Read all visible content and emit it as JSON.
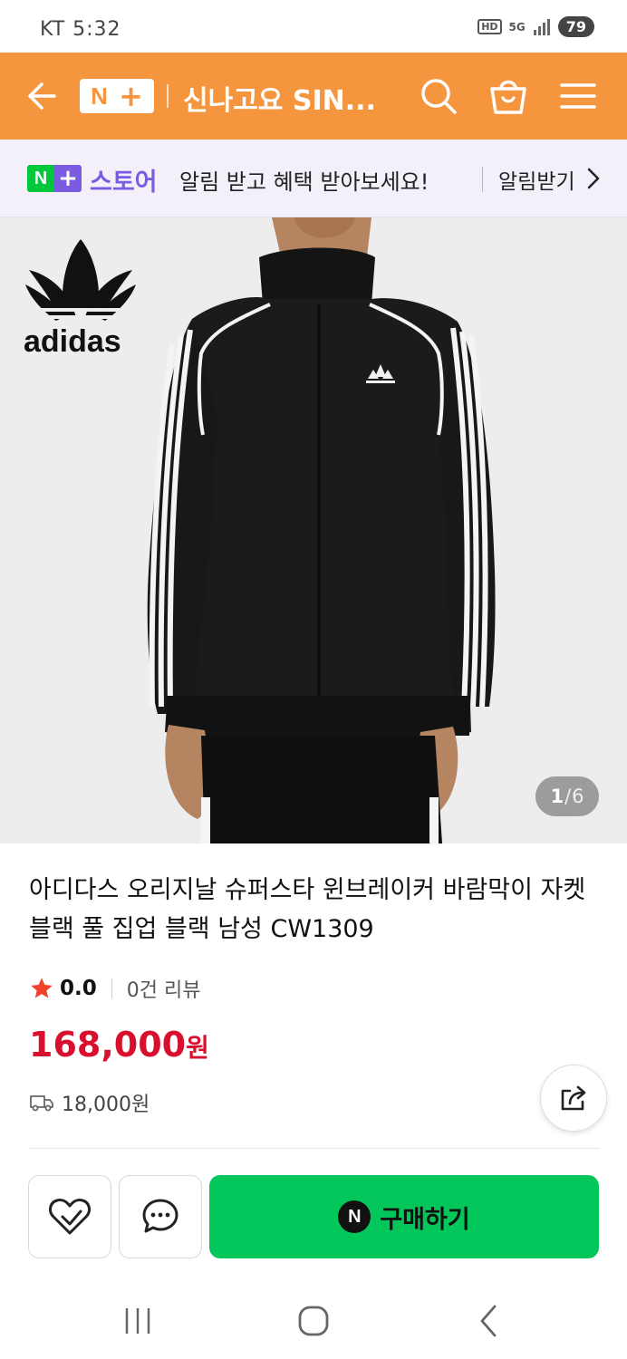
{
  "status_bar": {
    "carrier_time": "KT 5:32",
    "hd_label": "HD",
    "network_label": "5G",
    "battery": "79"
  },
  "top_bar": {
    "brand_n": "N",
    "brand_plus": "+",
    "title": "신나고요 SIN...",
    "icons": [
      "back-arrow-icon",
      "search-icon",
      "shopping-bag-icon",
      "menu-icon"
    ],
    "background_color": "#f5953d"
  },
  "promo_banner": {
    "badge_n": "N",
    "badge_plus": "+",
    "store_label": "스토어",
    "message": "알림 받고 혜택 받아보세요!",
    "action_label": "알림받기"
  },
  "gallery": {
    "brand_logo": "adidas",
    "current": "1",
    "separator": "/",
    "total": "6"
  },
  "product": {
    "name": "아디다스 오리지날 슈퍼스타 윈브레이커 바람막이 자켓 블랙 풀 집업 블랙 남성 CW1309",
    "rating": "0.0",
    "review_count": "0건 리뷰",
    "price": "168,000",
    "currency": "원",
    "shipping_fee": "18,000원",
    "price_color": "#d8102e"
  },
  "action_bar": {
    "buy_badge": "N",
    "buy_label": "구매하기",
    "buy_color": "#03c75a",
    "icons": [
      "wishlist-heart-icon",
      "chat-icon"
    ]
  },
  "nav_bar": {
    "icons": [
      "recent-apps-icon",
      "home-icon",
      "back-icon"
    ]
  }
}
